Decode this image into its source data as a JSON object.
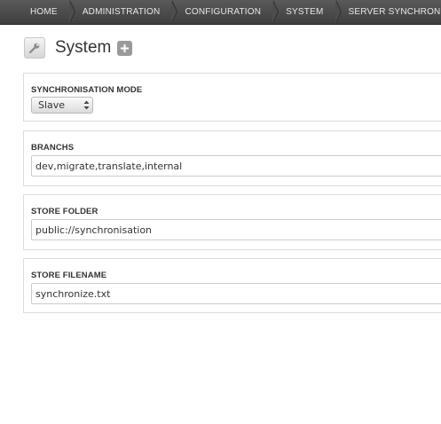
{
  "breadcrumbs": [
    "Home",
    "Administration",
    "Configuration",
    "System",
    "Server synchronisat"
  ],
  "page": {
    "title": "System"
  },
  "form": {
    "sync_mode": {
      "label": "Synchronisation mode",
      "value": "Slave"
    },
    "branchs": {
      "label": "Branchs",
      "value": "dev,migrate,translate,internal"
    },
    "store_folder": {
      "label": "Store folder",
      "value": "public://synchronisation"
    },
    "store_filename": {
      "label": "Store filename",
      "value": "synchronize.txt"
    }
  },
  "icons": {
    "title_icon": "wrench-icon",
    "add_icon": "plus-icon",
    "select_icon": "up-down-arrows-icon"
  }
}
